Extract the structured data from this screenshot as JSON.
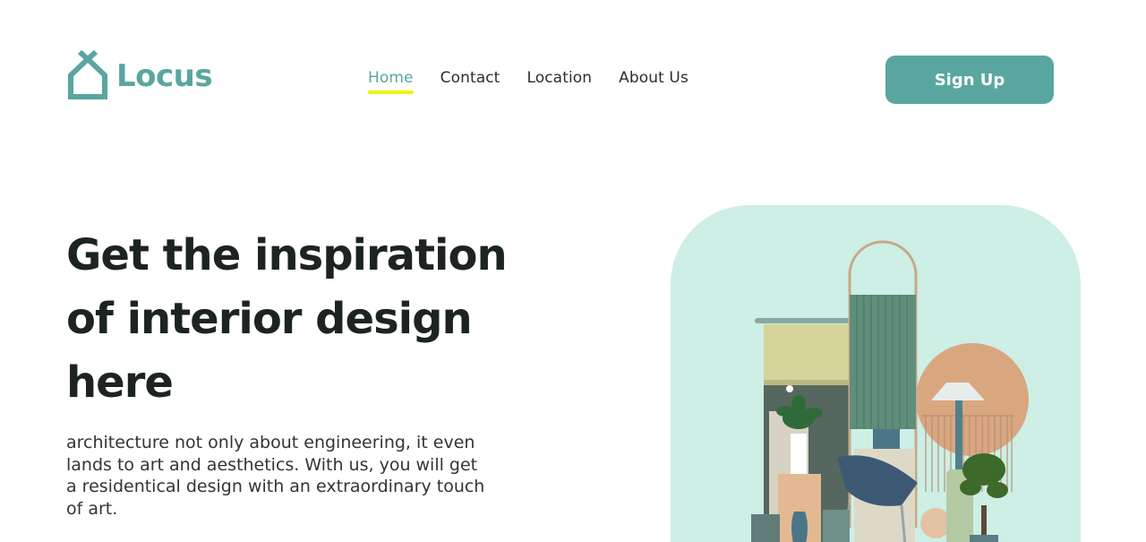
{
  "brand": {
    "name": "Locus",
    "icon": "house-icon",
    "color": "#59a6a0"
  },
  "nav": {
    "items": [
      {
        "label": "Home",
        "active": true
      },
      {
        "label": "Contact",
        "active": false
      },
      {
        "label": "Location",
        "active": false
      },
      {
        "label": "About Us",
        "active": false
      }
    ],
    "active_underline_color": "#f0f20a"
  },
  "header": {
    "signup_label": "Sign Up"
  },
  "hero": {
    "headline_lines": [
      "Get the inspiration",
      "of interior design",
      "here"
    ],
    "description_lines": [
      "architecture not only about engineering, it even",
      "lands to art and aesthetics. With us, you will get",
      "a residentical design with an extraordinary touch",
      "of art."
    ],
    "image_name": "interior-design-illustration",
    "image_bg": "#cdefe6"
  },
  "colors": {
    "accent": "#59a6a0",
    "text": "#1c2421",
    "highlight": "#f0f20a"
  }
}
